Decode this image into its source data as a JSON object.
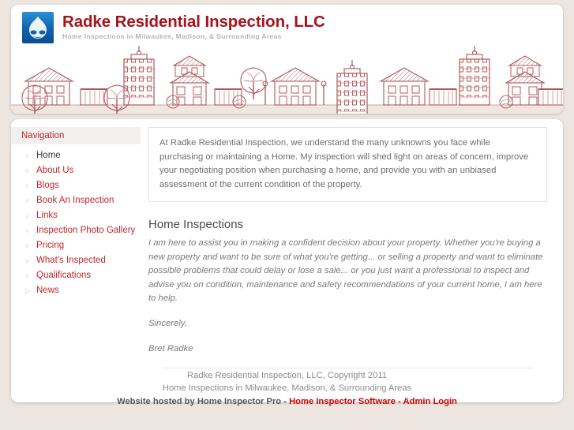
{
  "site": {
    "title": "Radke Residential Inspection, LLC",
    "slogan": "Home Inspections in Milwaukee, Madison, & Surrounding Areas",
    "logo_icon": "drupal-drop-icon",
    "banner_icon": "neighborhood-houses-illustration",
    "title_color": "#a3151c",
    "slogan_color": "#b9b4b1"
  },
  "sidebar": {
    "block_title": "Navigation",
    "items": [
      {
        "label": "Home",
        "bullet": "circle",
        "active": true
      },
      {
        "label": "About Us",
        "bullet": "circle",
        "active": false
      },
      {
        "label": "Blogs",
        "bullet": "circle",
        "active": false
      },
      {
        "label": "Book An Inspection",
        "bullet": "circle",
        "active": false
      },
      {
        "label": "Links",
        "bullet": "circle",
        "active": false
      },
      {
        "label": "Inspection Photo Gallery",
        "bullet": "circle",
        "active": false
      },
      {
        "label": "Pricing",
        "bullet": "circle",
        "active": false
      },
      {
        "label": "What's Inspected",
        "bullet": "circle",
        "active": false
      },
      {
        "label": "Qualifications",
        "bullet": "circle",
        "active": false
      },
      {
        "label": "News",
        "bullet": "triangle",
        "active": false
      }
    ],
    "link_color": "#c2272d",
    "active_color": "#3b3b3b"
  },
  "main": {
    "intro": "At Radke Residential Inspection, we understand the many unknowns you face while purchasing or maintaining a Home. My inspection will shed light on areas of concern, improve your negotiating position when purchasing a home, and provide you with an unbiased assessment of the current condition of the property.",
    "section_title": "Home Inspections",
    "body": "I am here to assist you in making a confident decision about your property. Whether you're buying a new property and want to be sure of what you're getting... or selling a property and want to eliminate possible problems that could delay or lose a sale... or you just want a professional to inspect and advise you on condition, maintenance and safety recommendations of your current home, I am here to help.",
    "closing": "Sincerely,",
    "signature": "Bret Radke"
  },
  "footer": {
    "line1": "Radke Residential Inspection, LLC, Copyright 2011",
    "line2": "Home Inspections in Milwaukee, Madison, & Surrounding Areas",
    "hosted_prefix": "Website hosted by Home Inspector Pro - ",
    "link_software": "Home Inspector Software",
    "link_separator": " - ",
    "link_admin": "Admin Login",
    "link_color": "#cc0000"
  }
}
